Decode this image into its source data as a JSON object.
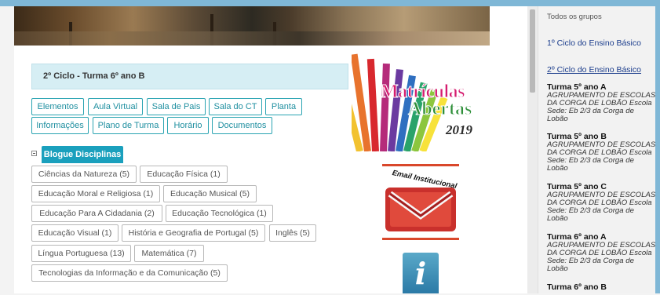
{
  "header": {
    "banner_alt": ""
  },
  "class_title": "2º Ciclo - Turma 6º ano B",
  "nav_buttons": [
    "Elementos",
    "Aula Virtual",
    "Sala de Pais",
    "Sala do CT",
    "Planta",
    "Informações",
    "Plano de Turma",
    "Horário",
    "Documentos"
  ],
  "blog_tab": "Blogue Disciplinas",
  "tags": [
    "Ciências da Natureza (5)",
    "Educação Física (1)",
    "Educação Moral e Religiosa (1)",
    "Educação Musical (5)",
    "Educação Para A Cidadania (2)",
    "Educação Tecnológica (1)",
    "Educação Visual (1)",
    "História e Geografia de Portugal (5)",
    "Inglês (5)",
    "Língua Portuguesa (13)",
    "Matemática (7)",
    "Tecnologias da Informação e da Comunicação (5)"
  ],
  "ads": {
    "matriculas_line1": "Matrículas",
    "matriculas_line2": "Abertas",
    "matriculas_year": "2019",
    "email_label": "Email Institucional",
    "info_glyph": "i"
  },
  "sidebar": {
    "todos": "Todos os grupos",
    "ciclo1": "1º Ciclo do Ensino Básico",
    "ciclo2": "2º Ciclo do Ensino Básico",
    "turmas": [
      {
        "name": "Turma 5º ano A",
        "desc": "AGRUPAMENTO DE ESCOLAS DA CORGA DE LOBÃO Escola Sede: Eb 2/3 da Corga de Lobão"
      },
      {
        "name": "Turma 5º ano B",
        "desc": "AGRUPAMENTO DE ESCOLAS DA CORGA DE LOBÃO Escola Sede: Eb 2/3 da Corga de Lobão"
      },
      {
        "name": "Turma 5º ano C",
        "desc": "AGRUPAMENTO DE ESCOLAS DA CORGA DE LOBÃO Escola Sede: Eb 2/3 da Corga de Lobão"
      },
      {
        "name": "Turma 6º ano A",
        "desc": "AGRUPAMENTO DE ESCOLAS DA CORGA DE LOBÃO Escola Sede: Eb 2/3 da Corga de Lobão"
      },
      {
        "name": "Turma 6º ano B",
        "desc": ""
      }
    ]
  },
  "colors": {
    "accent": "#1aa0bd",
    "title_box": "#d6eef4",
    "link": "#1a3c8c"
  }
}
